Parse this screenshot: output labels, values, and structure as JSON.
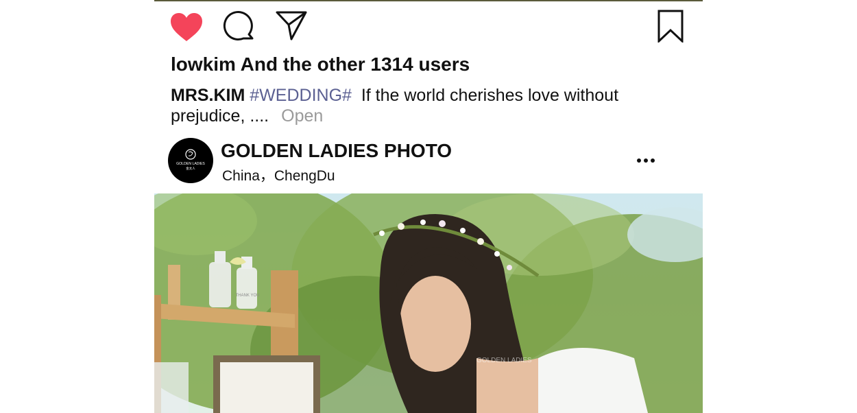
{
  "post": {
    "likes_text": "lowkim And the other 1314 users",
    "caption": {
      "username": "MRS.KIM",
      "hashtag": "#WEDDING#",
      "text": "If the world cherishes love without prejudice, ....",
      "open_label": "Open"
    },
    "account": {
      "name": "GOLDEN LADIES PHOTO",
      "location": "China，ChengDu",
      "avatar_logo_text": "GOLDEN LADIES",
      "avatar_logo_subtext": "金太人"
    },
    "icons": {
      "like": "heart-icon",
      "comment": "comment-icon",
      "share": "send-icon",
      "bookmark": "bookmark-icon",
      "more": "more-options-icon"
    },
    "colors": {
      "like": "#f4445a",
      "hashtag": "#5b6092",
      "open": "#9a9a9a"
    },
    "photo": {
      "watermark": "GOLDEN LADIES",
      "bottle_label": "THANK YOU"
    }
  }
}
